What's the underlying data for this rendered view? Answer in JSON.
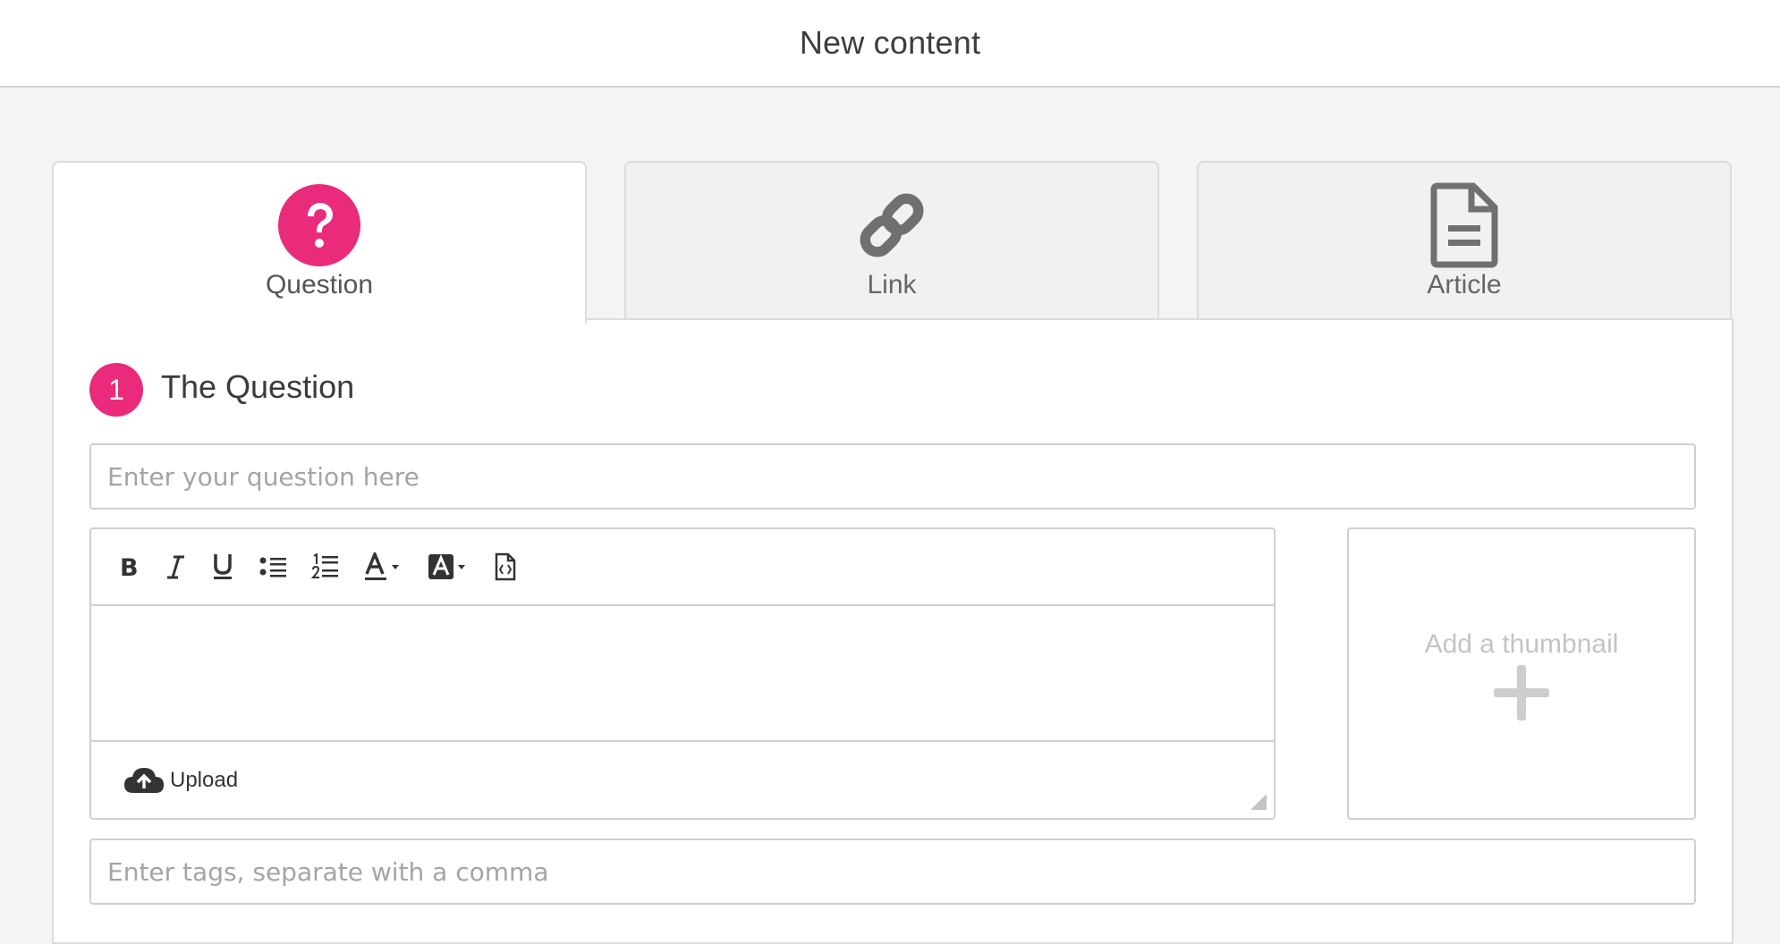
{
  "header": {
    "title": "New content"
  },
  "tabs": [
    {
      "label": "Question",
      "icon": "question-circle-icon",
      "active": true
    },
    {
      "label": "Link",
      "icon": "link-icon",
      "active": false
    },
    {
      "label": "Article",
      "icon": "document-icon",
      "active": false
    }
  ],
  "section": {
    "step_number": "1",
    "title": "The Question"
  },
  "question_input": {
    "placeholder": "Enter your question here",
    "value": ""
  },
  "editor": {
    "toolbar": [
      {
        "name": "bold",
        "icon": "bold-icon"
      },
      {
        "name": "italic",
        "icon": "italic-icon"
      },
      {
        "name": "underline",
        "icon": "underline-icon"
      },
      {
        "name": "bulleted-list",
        "icon": "bulleted-list-icon"
      },
      {
        "name": "numbered-list",
        "icon": "numbered-list-icon"
      },
      {
        "name": "text-color",
        "icon": "text-color-icon"
      },
      {
        "name": "highlight-color",
        "icon": "highlight-color-icon"
      },
      {
        "name": "source-code",
        "icon": "source-code-icon"
      }
    ],
    "body": "",
    "upload_label": "Upload"
  },
  "thumbnail": {
    "label": "Add a thumbnail"
  },
  "tags_input": {
    "placeholder": "Enter tags, separate with a comma",
    "value": ""
  },
  "colors": {
    "accent": "#ea2a7b",
    "icon_gray": "#707070",
    "background": "#f4f4f3"
  }
}
